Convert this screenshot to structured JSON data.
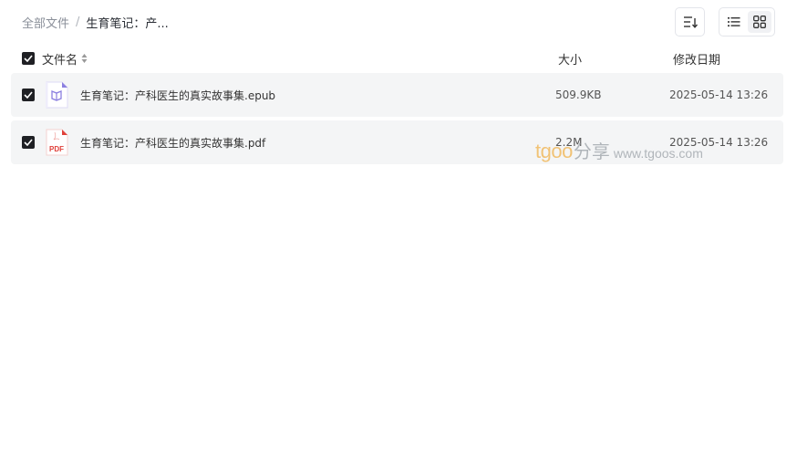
{
  "breadcrumb": {
    "root": "全部文件",
    "separator": "/",
    "current": "生育笔记：产..."
  },
  "toolbar": {
    "sort_icon": "sort-icon",
    "list_view_icon": "list-view-icon",
    "grid_view_icon": "grid-view-icon"
  },
  "table": {
    "columns": {
      "name": "文件名",
      "size": "大小",
      "date": "修改日期"
    },
    "rows": [
      {
        "name": "生育笔记：产科医生的真实故事集.epub",
        "size": "509.9KB",
        "date": "2025-05-14 13:26",
        "type": "epub",
        "checked": true
      },
      {
        "name": "生育笔记：产科医生的真实故事集.pdf",
        "size": "2.2M",
        "date": "2025-05-14 13:26",
        "type": "pdf",
        "icon_label": "PDF",
        "checked": true
      }
    ]
  },
  "watermark": {
    "brand": "tgoo",
    "share": "分享",
    "url": "www.tgoos.com"
  },
  "colors": {
    "row_bg": "#f4f5f6",
    "checkbox": "#1f2024",
    "epub_accent": "#8b7fe0",
    "pdf_accent": "#e0403a",
    "watermark_brand": "#f0b24a"
  }
}
